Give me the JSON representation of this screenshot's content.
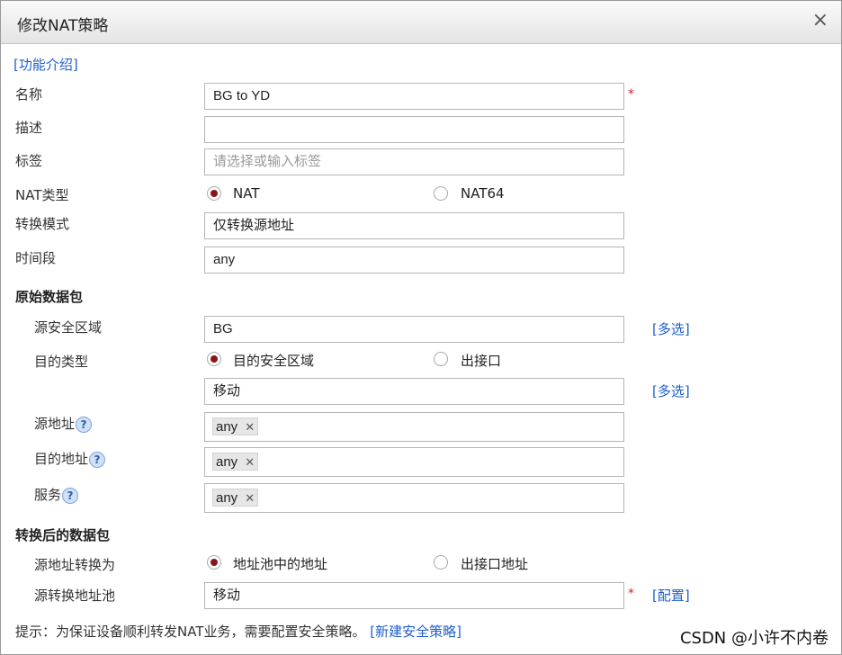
{
  "dialog": {
    "title": "修改NAT策略",
    "close": "×"
  },
  "intro_link": "[功能介绍]",
  "fields": {
    "name_label": "名称",
    "name_value": "BG to YD",
    "required": "*",
    "desc_label": "描述",
    "desc_value": "",
    "tag_label": "标签",
    "tag_placeholder": "请选择或输入标签",
    "nat_type_label": "NAT类型",
    "nat_type_opt1": "NAT",
    "nat_type_opt2": "NAT64",
    "mode_label": "转换模式",
    "mode_value": "仅转换源地址",
    "time_label": "时间段",
    "time_value": "any"
  },
  "original": {
    "heading": "原始数据包",
    "src_zone_label": "源安全区域",
    "src_zone_value": "BG",
    "multi_select": "[多选]",
    "dst_type_label": "目的类型",
    "dst_type_opt1": "目的安全区域",
    "dst_type_opt2": "出接口",
    "dst_zone_value": "移动",
    "multi_select2": "[多选]",
    "src_addr_label": "源地址",
    "src_addr_tag": "any",
    "dst_addr_label": "目的地址",
    "dst_addr_tag": "any",
    "service_label": "服务",
    "service_tag": "any",
    "help_icon": "?",
    "remove": "✕"
  },
  "translated": {
    "heading": "转换后的数据包",
    "src_trans_label": "源地址转换为",
    "src_trans_opt1": "地址池中的地址",
    "src_trans_opt2": "出接口地址",
    "pool_label": "源转换地址池",
    "pool_value": "移动",
    "configure": "[配置]"
  },
  "hint": {
    "text": "提示：为保证设备顺利转发NAT业务，需要配置安全策略。",
    "link": "[新建安全策略]"
  },
  "watermark": "CSDN @小许不内卷",
  "colors": {
    "link": "#1f5fcc",
    "required": "#e02020",
    "radio_selected": "#8b1414"
  }
}
